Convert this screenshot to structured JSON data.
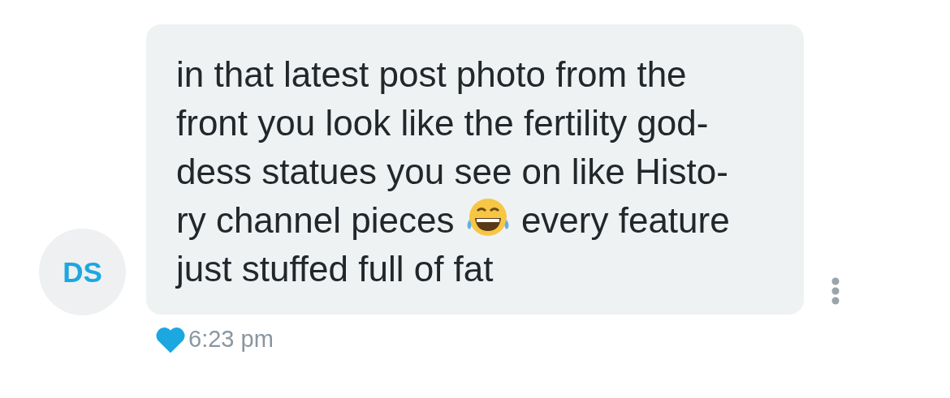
{
  "message": {
    "sender_initials": "DS",
    "text_before": "in that latest post photo from the\nfront you look like the fertility god-\ndess statues you see on like Histo-\nry channel pieces ",
    "text_after": " every feature\njust stuffed full of fat",
    "liked": true,
    "time": "6:23 pm"
  }
}
